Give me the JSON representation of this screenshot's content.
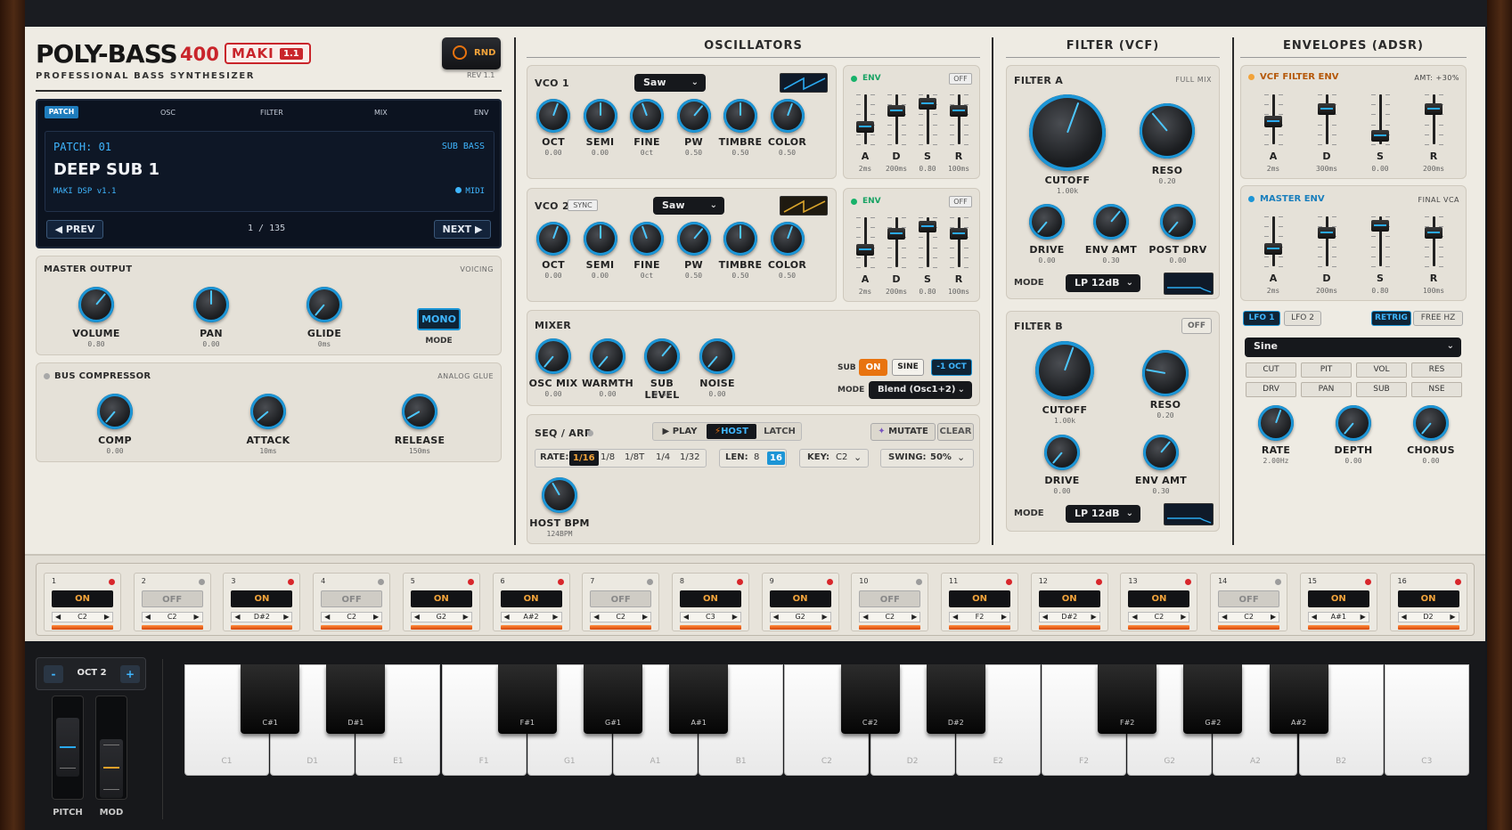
{
  "brand": {
    "name": "POLY-BASS",
    "model": "400",
    "badge": "MAKI",
    "badge_ver": "1.1",
    "subtitle": "PROFESSIONAL BASS SYNTHESIZER",
    "rev": "REV 1.1",
    "rnd_label": "RND"
  },
  "patch": {
    "tabs": [
      "PATCH",
      "OSC",
      "FILTER",
      "MIX",
      "ENV"
    ],
    "patch_no": "PATCH: 01",
    "category": "SUB BASS",
    "name": "DEEP SUB 1",
    "engine": "MAKI DSP v1.1",
    "midi": "MIDI",
    "prev": "PREV",
    "next": "NEXT",
    "counter": "1 / 135"
  },
  "master": {
    "title": "MASTER OUTPUT",
    "tag": "VOICING",
    "knobs": [
      {
        "label": "VOLUME",
        "value": "0.80"
      },
      {
        "label": "PAN",
        "value": "0.00"
      },
      {
        "label": "GLIDE",
        "value": "0ms"
      }
    ],
    "mode_btn": "MONO",
    "mode_label": "MODE"
  },
  "comp": {
    "title": "BUS COMPRESSOR",
    "tag": "ANALOG GLUE",
    "knobs": [
      {
        "label": "COMP",
        "value": "0.00"
      },
      {
        "label": "ATTACK",
        "value": "10ms"
      },
      {
        "label": "RELEASE",
        "value": "150ms"
      }
    ]
  },
  "osc": {
    "title": "OSCILLATORS",
    "vco1": {
      "name": "VCO 1",
      "wave": "Saw",
      "knobs": [
        {
          "label": "OCT",
          "value": "0.00"
        },
        {
          "label": "SEMI",
          "value": "0.00"
        },
        {
          "label": "FINE",
          "value": "0ct"
        },
        {
          "label": "PW",
          "value": "0.50"
        },
        {
          "label": "TIMBRE",
          "value": "0.50"
        },
        {
          "label": "COLOR",
          "value": "0.50"
        }
      ]
    },
    "vco2": {
      "name": "VCO 2",
      "sync": "SYNC",
      "wave": "Saw",
      "knobs": [
        {
          "label": "OCT",
          "value": "0.00"
        },
        {
          "label": "SEMI",
          "value": "0.00"
        },
        {
          "label": "FINE",
          "value": "0ct"
        },
        {
          "label": "PW",
          "value": "0.50"
        },
        {
          "label": "TIMBRE",
          "value": "0.50"
        },
        {
          "label": "COLOR",
          "value": "0.50"
        }
      ]
    },
    "env1": {
      "title": "ENV",
      "off": "OFF",
      "sliders": [
        {
          "label": "A",
          "value": "2ms"
        },
        {
          "label": "D",
          "value": "200ms"
        },
        {
          "label": "S",
          "value": "0.80"
        },
        {
          "label": "R",
          "value": "100ms"
        }
      ]
    },
    "env2": {
      "title": "ENV",
      "off": "OFF",
      "sliders": [
        {
          "label": "A",
          "value": "2ms"
        },
        {
          "label": "D",
          "value": "200ms"
        },
        {
          "label": "S",
          "value": "0.80"
        },
        {
          "label": "R",
          "value": "100ms"
        }
      ]
    }
  },
  "mixer": {
    "title": "MIXER",
    "knobs": [
      {
        "label": "OSC MIX",
        "value": "0.00"
      },
      {
        "label": "WARMTH",
        "value": "0.00"
      },
      {
        "label": "SUB LEVEL",
        "value": "0.50"
      },
      {
        "label": "NOISE",
        "value": "0.00"
      }
    ],
    "sub_label": "SUB",
    "sub_on": "ON",
    "sub_sine": "SINE",
    "sub_oct": "-1 OCT",
    "mode_label": "MODE",
    "mode_value": "Blend (Osc1+2)"
  },
  "seq": {
    "title": "SEQ / ARP",
    "play": "PLAY",
    "host": "HOST",
    "latch": "LATCH",
    "mutate": "MUTATE",
    "clear": "CLEAR",
    "rate_label": "RATE:",
    "rates": [
      "1/16",
      "1/8",
      "1/8T",
      "1/4",
      "1/32"
    ],
    "len_label": "LEN:",
    "lens": [
      "8",
      "16"
    ],
    "key_label": "KEY:",
    "key_value": "C2",
    "swing_label": "SWING:",
    "swing_value": "50%",
    "bpm_label": "HOST BPM",
    "bpm_value": "124BPM"
  },
  "filter": {
    "title": "FILTER (VCF)",
    "a": {
      "name": "FILTER A",
      "tag": "FULL MIX",
      "cutoff": {
        "label": "CUTOFF",
        "value": "1.00k"
      },
      "reso": {
        "label": "RESO",
        "value": "0.20"
      },
      "drive": {
        "label": "DRIVE",
        "value": "0.00"
      },
      "envamt": {
        "label": "ENV AMT",
        "value": "0.30"
      },
      "postdrv": {
        "label": "POST DRV",
        "value": "0.00"
      },
      "mode_label": "MODE",
      "mode": "LP 12dB"
    },
    "b": {
      "name": "FILTER B",
      "off": "OFF",
      "cutoff": {
        "label": "CUTOFF",
        "value": "1.00k"
      },
      "reso": {
        "label": "RESO",
        "value": "0.20"
      },
      "drive": {
        "label": "DRIVE",
        "value": "0.00"
      },
      "envamt": {
        "label": "ENV AMT",
        "value": "0.30"
      },
      "mode_label": "MODE",
      "mode": "LP 12dB"
    }
  },
  "envelopes": {
    "title": "ENVELOPES (ADSR)",
    "vcf": {
      "name": "VCF FILTER ENV",
      "tag": "AMT: +30%",
      "sliders": [
        {
          "label": "A",
          "value": "2ms"
        },
        {
          "label": "D",
          "value": "300ms"
        },
        {
          "label": "S",
          "value": "0.00"
        },
        {
          "label": "R",
          "value": "200ms"
        }
      ]
    },
    "master": {
      "name": "MASTER ENV",
      "tag": "FINAL VCA",
      "sliders": [
        {
          "label": "A",
          "value": "2ms"
        },
        {
          "label": "D",
          "value": "200ms"
        },
        {
          "label": "S",
          "value": "0.80"
        },
        {
          "label": "R",
          "value": "100ms"
        }
      ]
    }
  },
  "lfo": {
    "tabs": [
      "LFO 1",
      "LFO 2"
    ],
    "retrig": "RETRIG",
    "freehz": "FREE HZ",
    "wave": "Sine",
    "dest": [
      "CUT",
      "PIT",
      "VOL",
      "RES",
      "DRV",
      "PAN",
      "SUB",
      "NSE"
    ],
    "knobs": [
      {
        "label": "RATE",
        "value": "2.00Hz"
      },
      {
        "label": "DEPTH",
        "value": "0.00"
      },
      {
        "label": "CHORUS",
        "value": "0.00"
      }
    ]
  },
  "steps": [
    {
      "n": "1",
      "on": true,
      "note": "C2"
    },
    {
      "n": "2",
      "on": false,
      "note": "C2"
    },
    {
      "n": "3",
      "on": true,
      "note": "D#2"
    },
    {
      "n": "4",
      "on": false,
      "note": "C2"
    },
    {
      "n": "5",
      "on": true,
      "note": "G2"
    },
    {
      "n": "6",
      "on": true,
      "note": "A#2"
    },
    {
      "n": "7",
      "on": false,
      "note": "C2"
    },
    {
      "n": "8",
      "on": true,
      "note": "C3"
    },
    {
      "n": "9",
      "on": true,
      "note": "G2"
    },
    {
      "n": "10",
      "on": false,
      "note": "C2"
    },
    {
      "n": "11",
      "on": true,
      "note": "F2"
    },
    {
      "n": "12",
      "on": true,
      "note": "D#2"
    },
    {
      "n": "13",
      "on": true,
      "note": "C2"
    },
    {
      "n": "14",
      "on": false,
      "note": "C2"
    },
    {
      "n": "15",
      "on": true,
      "note": "A#1"
    },
    {
      "n": "16",
      "on": true,
      "note": "D2"
    }
  ],
  "step_on_label": "ON",
  "step_off_label": "OFF",
  "keyboard": {
    "oct_minus": "-",
    "oct_label": "OCT 2",
    "oct_plus": "+",
    "pitch": "PITCH",
    "mod": "MOD",
    "white": [
      "C1",
      "D1",
      "E1",
      "F1",
      "G1",
      "A1",
      "B1",
      "C2",
      "D2",
      "E2",
      "F2",
      "G2",
      "A2",
      "B2",
      "C3"
    ],
    "black": [
      "C#1",
      "D#1",
      "F#1",
      "G#1",
      "A#1",
      "C#2",
      "D#2",
      "F#2",
      "G#2",
      "A#2"
    ]
  },
  "colors": {
    "accent": "#1c95d6",
    "orange": "#e8730f",
    "red": "#c9252b",
    "panel": "#eeebe3"
  }
}
